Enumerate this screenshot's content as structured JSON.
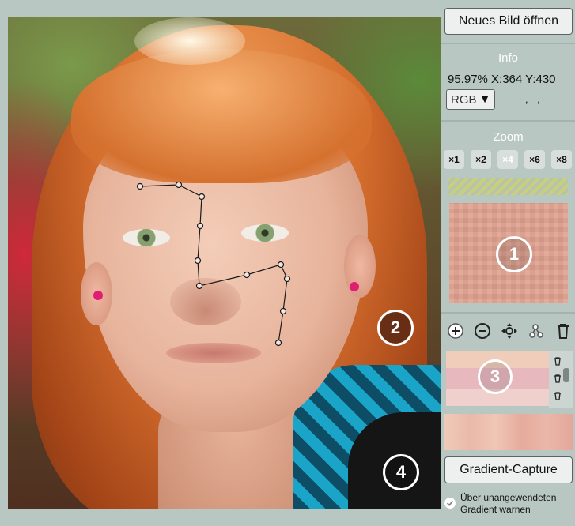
{
  "toolbar": {
    "open_image_label": "Neues Bild öffnen"
  },
  "info": {
    "title": "Info",
    "zoom_percent": "95.97%",
    "x_readout": "X:364",
    "y_readout": "Y:430",
    "color_mode": "RGB",
    "color_mode_arrow": "▼",
    "color_value": "- , - , -"
  },
  "zoom": {
    "title": "Zoom",
    "levels": [
      "×1",
      "×2",
      "×4",
      "×6",
      "×8"
    ],
    "active_level": "×4"
  },
  "badges": {
    "one": "1",
    "two": "2",
    "three": "3",
    "four": "4"
  },
  "actions": {
    "gradient_capture_label": "Gradient-Capture",
    "warn_label_line1": "Über unangewendeten",
    "warn_label_line2": "Gradient warnen"
  },
  "colors": {
    "panel_bg": "#b9c7c2",
    "swatch_1": "#f0ccba",
    "swatch_2": "#e8b8bf",
    "swatch_3": "#f0d0cc",
    "earring": "#e01e74"
  }
}
